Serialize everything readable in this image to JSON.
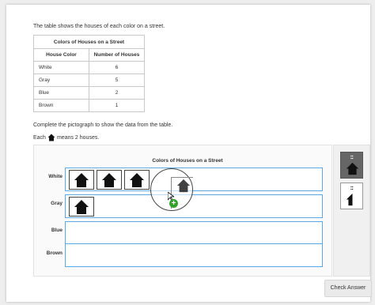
{
  "intro": "The table shows the houses of each color on a street.",
  "table": {
    "title": "Colors of Houses on a Street",
    "headers": [
      "House Color",
      "Number of Houses"
    ],
    "rows": [
      {
        "color": "White",
        "count": "6"
      },
      {
        "color": "Gray",
        "count": "5"
      },
      {
        "color": "Blue",
        "count": "2"
      },
      {
        "color": "Brown",
        "count": "1"
      }
    ]
  },
  "instruction": "Complete the pictograph to show the data from the table.",
  "key": {
    "prefix": "Each",
    "suffix": "means 2 houses.",
    "icon": "house-icon"
  },
  "pictograph": {
    "title": "Colors of Houses on a Street",
    "rows": [
      {
        "label": "White",
        "icons_placed": 3
      },
      {
        "label": "Gray",
        "icons_placed": 1
      },
      {
        "label": "Blue",
        "icons_placed": 0
      },
      {
        "label": "Brown",
        "icons_placed": 0
      }
    ]
  },
  "tools": [
    {
      "name": "whole-house-tool",
      "selected": true
    },
    {
      "name": "half-house-tool",
      "selected": false
    }
  ],
  "check_button": "Check Answer",
  "colors": {
    "accent": "#5aa9e6",
    "icon": "#111111",
    "plus": "#33a02c"
  }
}
